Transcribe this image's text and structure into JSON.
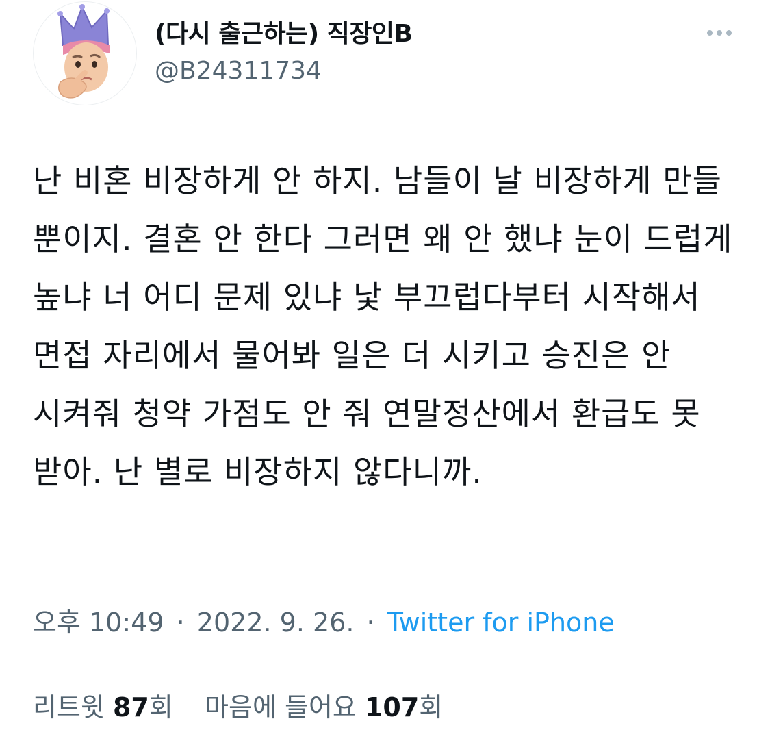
{
  "author": {
    "display_name": "(다시 출근하는) 직장인B",
    "handle": "@B24311734",
    "avatar": "memoji-thinking-crown"
  },
  "more_icon": "ellipsis-icon",
  "tweet": {
    "text": "난 비혼 비장하게 안 하지. 남들이 날 비장하게 만들 뿐이지. 결혼 안 한다 그러면 왜 안 했냐 눈이 드럽게 높냐 너 어디 문제 있냐 낯 부끄럽다부터 시작해서 면접 자리에서 물어봐 일은 더 시키고 승진은 안 시켜줘 청약 가점도 안 줘 연말정산에서 환급도 못 받아. 난 별로 비장하지 않다니까."
  },
  "meta": {
    "time": "오후 10:49",
    "separator": "·",
    "date": "2022. 9. 26.",
    "source": "Twitter for iPhone"
  },
  "stats": {
    "retweets_label": "리트윗",
    "retweets_count": "87",
    "retweets_suffix": "회",
    "likes_label": "마음에 들어요",
    "likes_count": "107",
    "likes_suffix": "회"
  },
  "colors": {
    "text": "#0f1419",
    "secondary": "#536471",
    "link": "#1d9bf0",
    "divider": "#e3e7ea"
  }
}
